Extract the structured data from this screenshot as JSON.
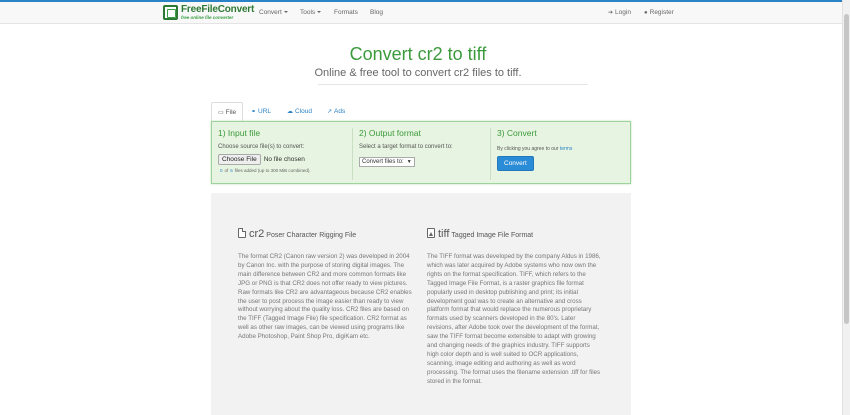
{
  "brand": {
    "name": "FreeFileConvert",
    "tagline": "free online file converter"
  },
  "nav": {
    "convert": "Convert",
    "tools": "Tools",
    "formats": "Formats",
    "blog": "Blog",
    "login": "Login",
    "register": "Register"
  },
  "hero": {
    "title": "Convert cr2 to tiff",
    "subtitle": "Online & free tool to convert cr2 files to tiff."
  },
  "tabs": [
    {
      "label": "File",
      "icon": "laptop-icon"
    },
    {
      "label": "URL",
      "icon": "link-icon"
    },
    {
      "label": "Cloud",
      "icon": "cloud-icon"
    },
    {
      "label": "Ads",
      "icon": "external-link-icon"
    }
  ],
  "panel": {
    "step1": {
      "heading": "1) Input file",
      "text": "Choose source file(s) to convert:",
      "choose_label": "Choose File",
      "no_file": "No file chosen",
      "count_current": "0",
      "count_of": "of",
      "count_max": "5",
      "count_suffix": "files added (up to 300 MiB combined)."
    },
    "step2": {
      "heading": "2) Output format",
      "text": "Select a target format to convert to:",
      "select_value": "Convert files to:"
    },
    "step3": {
      "heading": "3) Convert",
      "terms_prefix": "By clicking you agree to our",
      "terms_link": "terms",
      "button": "Convert"
    }
  },
  "formats": {
    "source": {
      "ext": "cr2",
      "full_name": "Poser Character Rigging File",
      "description": "The format CR2 (Canon raw version 2) was developed in 2004 by Canon Inc. with the purpose of storing digital images. The main difference between CR2 and more common formats like JPG or PNG is that CR2 does not offer ready to view pictures. Raw formats like CR2 are advantageous because CR2 enables the user to post process the image easier than ready to view without worrying about the quality loss. CR2 files are based on the TIFF (Tagged Image File) file specification. CR2 format as well as other raw images, can be viewed using programs like Adobe Photoshop, Paint Shop Pro, digiKam etc."
    },
    "target": {
      "ext": "tiff",
      "full_name": "Tagged Image File Format",
      "description": "The TIFF format was developed by the company Aldus in 1986, which was later acquired by Adobe systems who now own the rights on the format specification. TIFF, which refers to the Tagged Image File Format, is a raster graphics file format popularly used in desktop publishing and print; its initial development goal was to create an alternative and cross platform format that would replace the numerous proprietary formats used by scanners developed in the 80's. Later revisions, after Adobe took over the development of the format, saw the TIFF format become extensible to adapt with growing and changing needs of the graphics industry. TIFF supports high color depth and is well suited to OCR applications, scanning, image editing and authoring as well as word processing. The format uses the filename extension .tiff for files stored in the format."
    }
  },
  "colors": {
    "accent": "#2a83c6",
    "brand_green": "#3b9a3b",
    "panel_bg": "#e7f4e1",
    "panel_border": "#9fd39c",
    "info_bg": "#f2f2f2"
  }
}
